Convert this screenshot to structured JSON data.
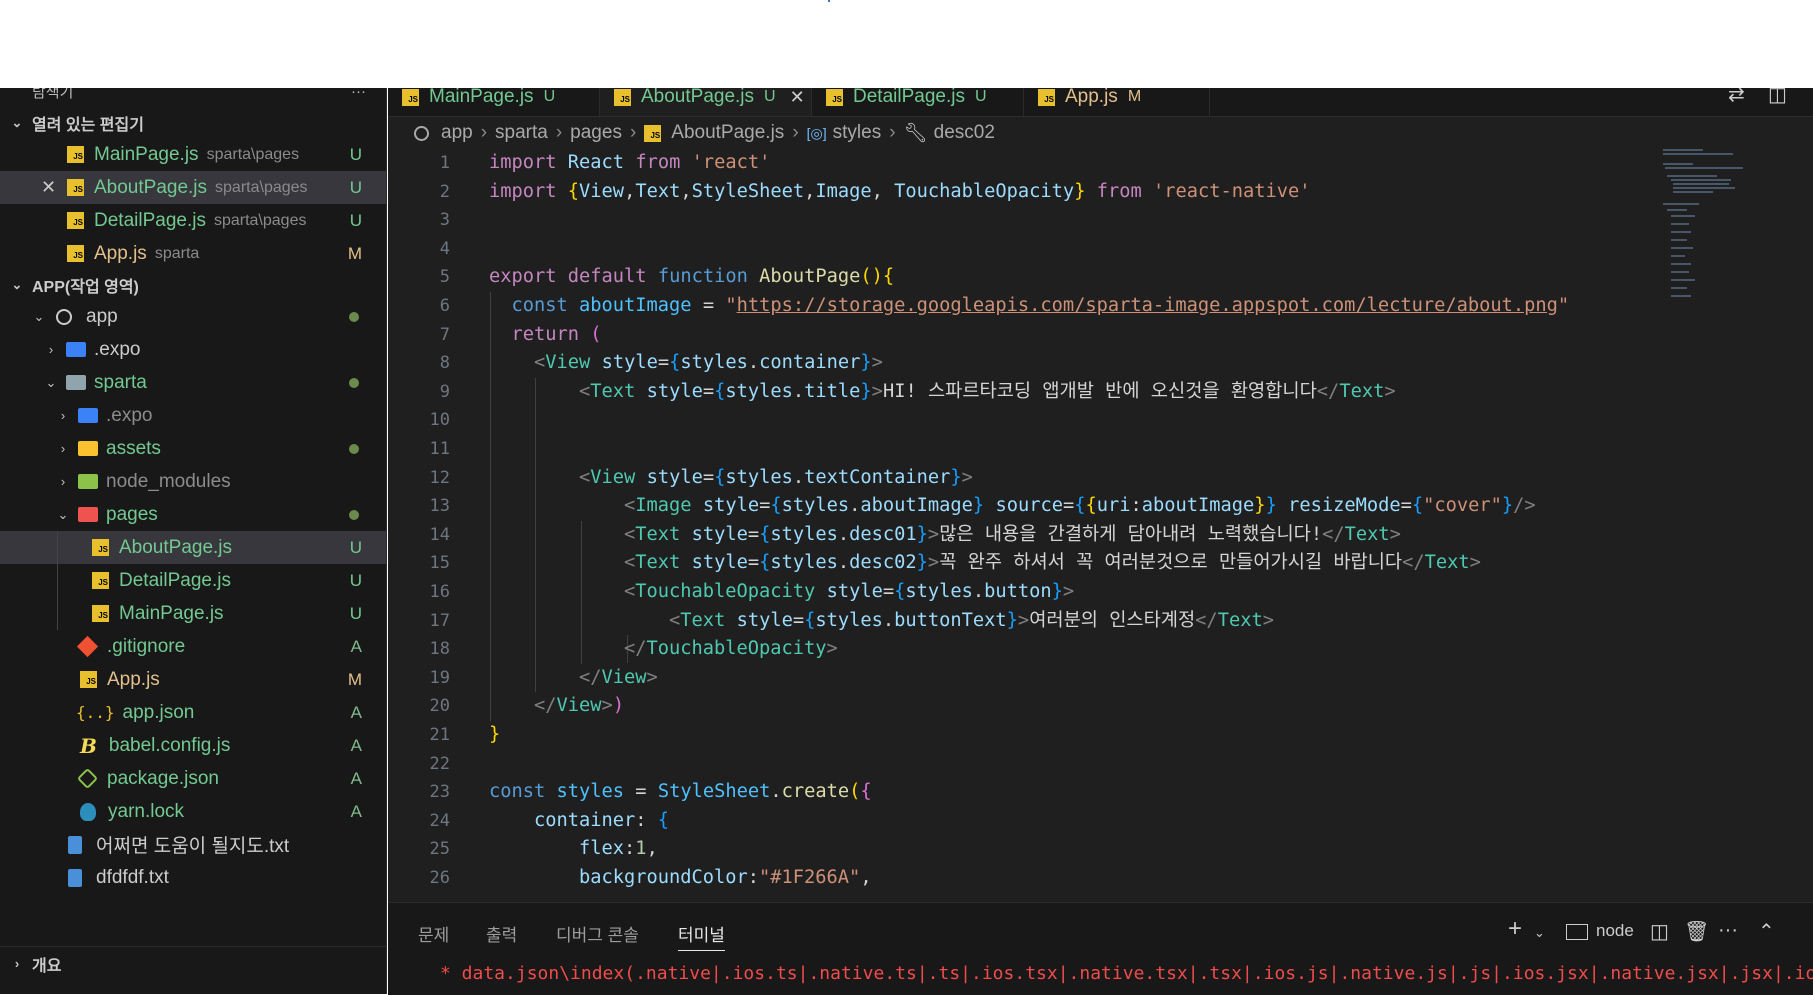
{
  "sidebar": {
    "title": "탐색기",
    "more": "···",
    "open_editors": {
      "label": "열려 있는 편집기",
      "items": [
        {
          "name": "MainPage.js",
          "path": "sparta\\pages",
          "status": "U"
        },
        {
          "name": "AboutPage.js",
          "path": "sparta\\pages",
          "status": "U"
        },
        {
          "name": "DetailPage.js",
          "path": "sparta\\pages",
          "status": "U"
        },
        {
          "name": "App.js",
          "path": "sparta",
          "status": "M"
        }
      ]
    },
    "workspace": {
      "label": "APP(작업 영역)",
      "tree": [
        {
          "name": "app"
        },
        {
          "name": ".expo"
        },
        {
          "name": "sparta"
        },
        {
          "name": ".expo"
        },
        {
          "name": "assets"
        },
        {
          "name": "node_modules"
        },
        {
          "name": "pages"
        },
        {
          "name": "AboutPage.js",
          "status": "U"
        },
        {
          "name": "DetailPage.js",
          "status": "U"
        },
        {
          "name": "MainPage.js",
          "status": "U"
        },
        {
          "name": ".gitignore",
          "status": "A"
        },
        {
          "name": "App.js",
          "status": "M"
        },
        {
          "name": "app.json",
          "status": "A"
        },
        {
          "name": "babel.config.js",
          "status": "A"
        },
        {
          "name": "package.json",
          "status": "A"
        },
        {
          "name": "yarn.lock",
          "status": "A"
        },
        {
          "name": "어쩌면 도움이 될지도.txt"
        },
        {
          "name": "dfdfdf.txt"
        }
      ]
    },
    "outline_label": "개요"
  },
  "tabs": [
    {
      "label": "MainPage.js",
      "status": "U"
    },
    {
      "label": "AboutPage.js",
      "status": "U",
      "close": "✕"
    },
    {
      "label": "DetailPage.js",
      "status": "U"
    },
    {
      "label": "App.js",
      "status": "M"
    }
  ],
  "breadcrumb": [
    "app",
    "sparta",
    "pages",
    "AboutPage.js",
    "styles",
    "desc02"
  ],
  "editor": {
    "line_numbers": [
      "1",
      "2",
      "3",
      "4",
      "5",
      "6",
      "7",
      "8",
      "9",
      "10",
      "11",
      "12",
      "13",
      "14",
      "15",
      "16",
      "17",
      "18",
      "19",
      "20",
      "21",
      "22",
      "23",
      "24",
      "25",
      "26"
    ],
    "strings": {
      "react": "'react'",
      "react_native": "'react-native'",
      "url": "https://storage.googleapis.com/sparta-image.appspot.com/lecture/about.png",
      "title_text": "HI! 스파르타코딩 앱개발 반에 오신것을 환영합니다",
      "desc01_text": "많은 내용을 간결하게 담아내려 노력했습니다!",
      "desc02_text": "꼭 완주 하셔서 꼭 여러분것으로 만들어가시길 바랍니다",
      "button_text": "여러분의 인스타계정",
      "cover": "\"cover\"",
      "bg_color": "\"#1F266A\""
    }
  },
  "panel": {
    "tabs": [
      "문제",
      "출력",
      "디버그 콘솔",
      "터미널"
    ],
    "active_tab": "터미널",
    "shell_label": "node",
    "terminal_line": "* data.json\\index(.native|.ios.ts|.native.ts|.ts|.ios.tsx|.native.tsx|.tsx|.ios.js|.native.js|.js|.ios.jsx|.native.jsx|.jsx|.ios.json|"
  },
  "colors": {
    "editor_bg": "#1f1f1f",
    "sidebar_bg": "#181818",
    "untracked": "#73c991",
    "modified": "#e2c08d"
  }
}
